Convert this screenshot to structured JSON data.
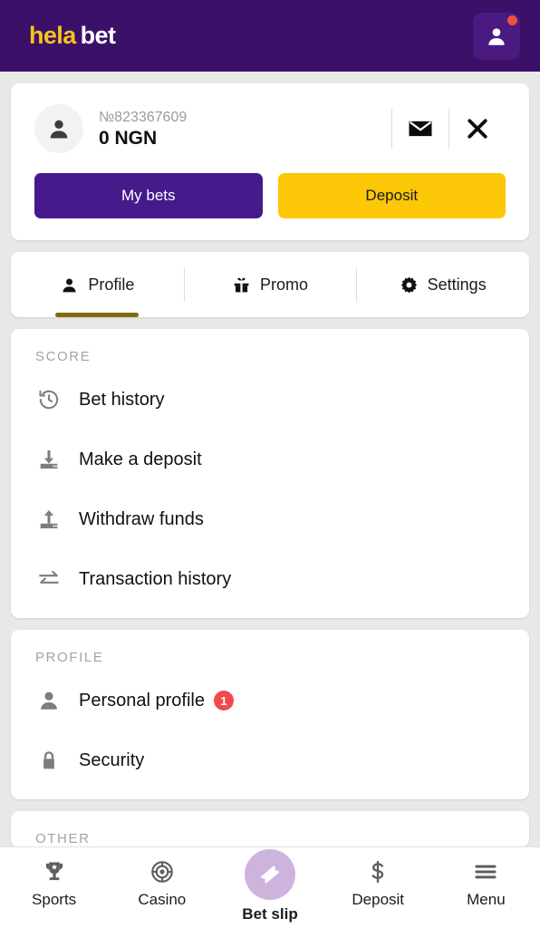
{
  "header": {
    "logo_primary": "hela",
    "logo_secondary": "bet",
    "avatar_icon": "person-icon",
    "notification_dot": true
  },
  "account": {
    "avatar_icon": "person-icon",
    "id": "№823367609",
    "balance": "0 NGN",
    "mail_icon": "envelope-icon",
    "close_icon": "close-icon",
    "buttons": {
      "my_bets": "My bets",
      "deposit": "Deposit"
    }
  },
  "tabs": [
    {
      "label": "Profile",
      "icon": "person-icon",
      "active": true
    },
    {
      "label": "Promo",
      "icon": "gift-icon",
      "active": false
    },
    {
      "label": "Settings",
      "icon": "gear-icon",
      "active": false
    }
  ],
  "sections": [
    {
      "title": "SCORE",
      "items": [
        {
          "label": "Bet history",
          "icon": "history-icon",
          "badge": null
        },
        {
          "label": "Make a deposit",
          "icon": "download-icon",
          "badge": null
        },
        {
          "label": "Withdraw funds",
          "icon": "upload-icon",
          "badge": null
        },
        {
          "label": "Transaction history",
          "icon": "transfer-icon",
          "badge": null
        }
      ]
    },
    {
      "title": "PROFILE",
      "items": [
        {
          "label": "Personal profile",
          "icon": "person-icon",
          "badge": "1"
        },
        {
          "label": "Security",
          "icon": "lock-icon",
          "badge": null
        }
      ]
    }
  ],
  "clipped_section": {
    "title": "OTHER"
  },
  "bottom_nav": [
    {
      "label": "Sports",
      "icon": "trophy-icon",
      "active": false
    },
    {
      "label": "Casino",
      "icon": "chip-icon",
      "active": false
    },
    {
      "label": "Bet slip",
      "icon": "ticket-icon",
      "active": true
    },
    {
      "label": "Deposit",
      "icon": "dollar-icon",
      "active": false
    },
    {
      "label": "Menu",
      "icon": "hamburger-icon",
      "active": false
    }
  ],
  "colors": {
    "header_purple": "#3b1068",
    "button_purple": "#461a8a",
    "accent_yellow": "#fbc707",
    "tab_underline": "#806a0e",
    "badge_red": "#f2494f",
    "bubble_lavender": "#cdb4dd",
    "page_background": "#e8e8e8"
  }
}
